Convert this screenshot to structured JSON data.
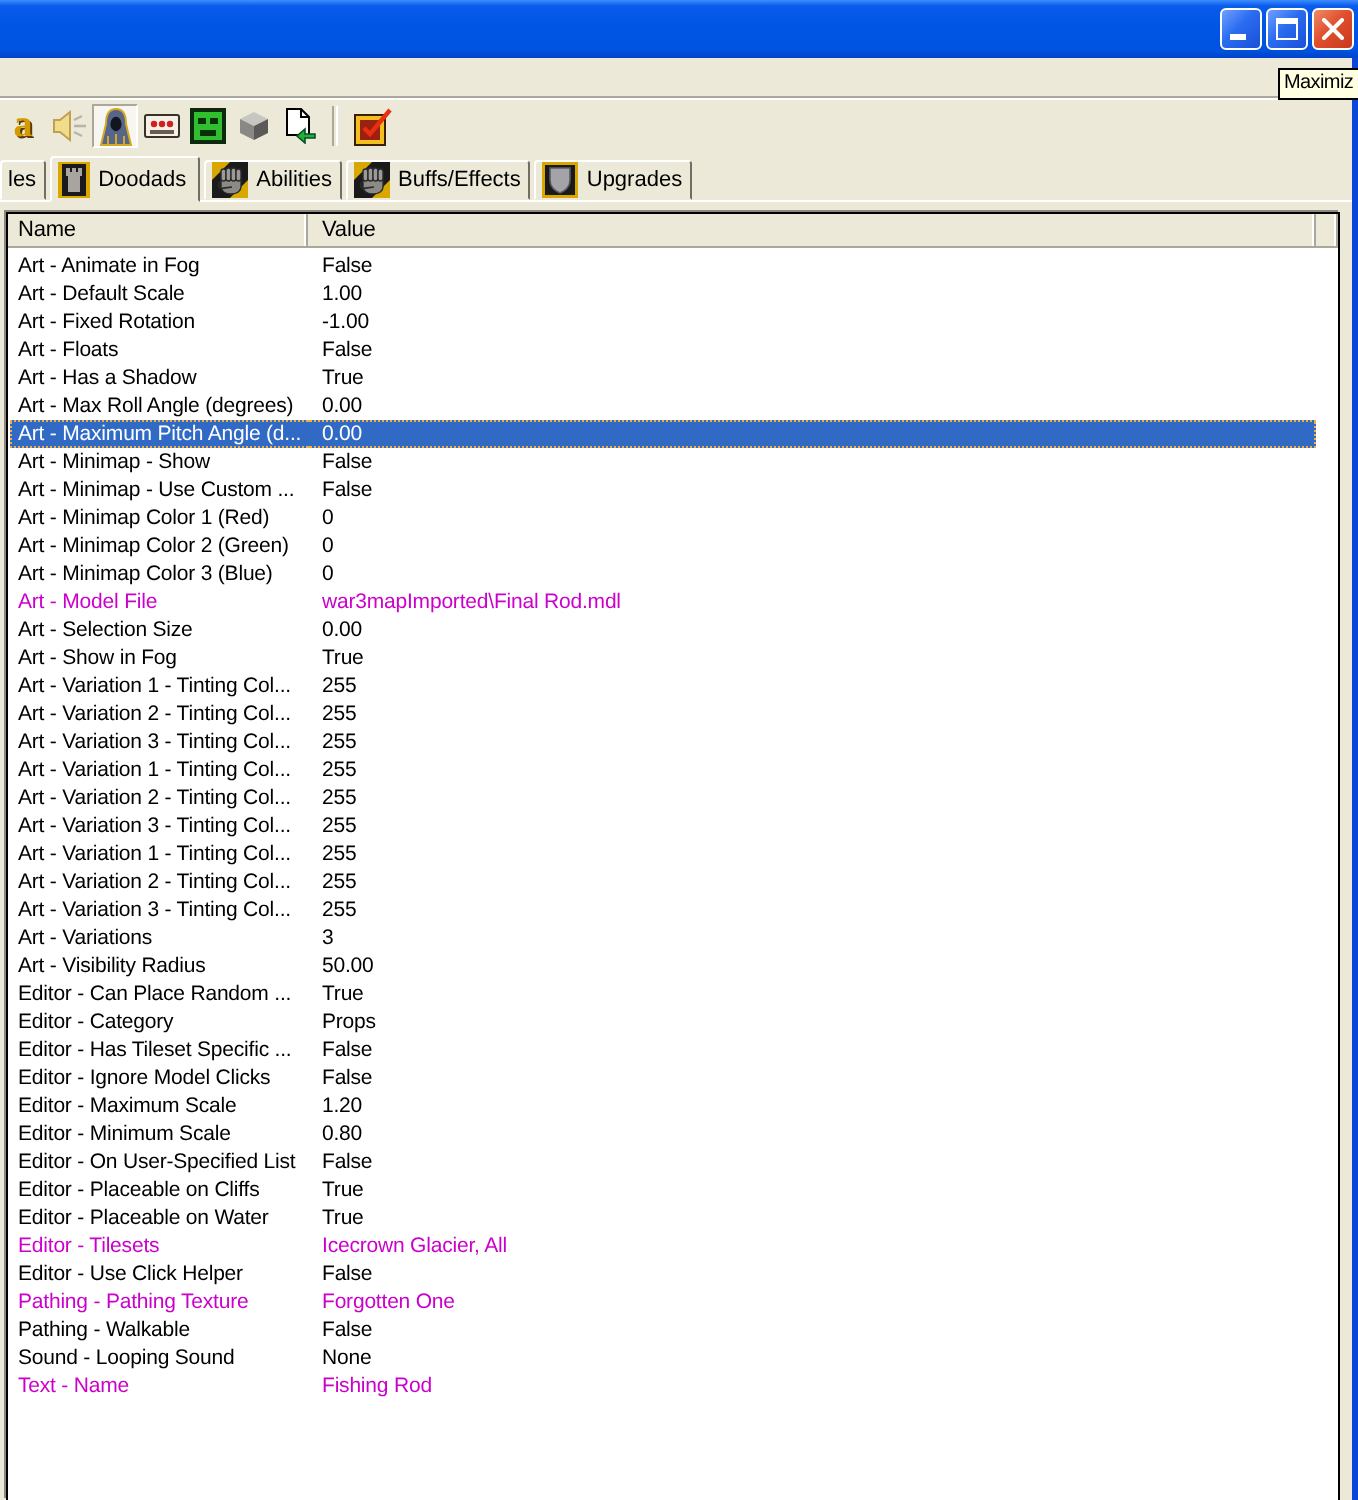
{
  "window": {
    "tooltip": "Maximiz"
  },
  "toolbar": {
    "groups": [
      [
        {
          "kind": "letter",
          "symbol": "a",
          "selected": false
        },
        {
          "kind": "icon",
          "selected": false
        },
        {
          "kind": "icon",
          "selected": true
        },
        {
          "kind": "icon",
          "selected": false
        },
        {
          "kind": "icon",
          "selected": false
        },
        {
          "kind": "icon",
          "selected": false
        },
        {
          "kind": "icon",
          "selected": false
        }
      ],
      [
        {
          "kind": "icon",
          "selected": false
        }
      ]
    ]
  },
  "tabs": [
    {
      "label": "les",
      "selected": false
    },
    {
      "label": "Doodads",
      "selected": true
    },
    {
      "label": "Abilities",
      "selected": false
    },
    {
      "label": "Buffs/Effects",
      "selected": false
    },
    {
      "label": "Upgrades",
      "selected": false
    }
  ],
  "table": {
    "columns": [
      "Name",
      "Value"
    ],
    "rows": [
      {
        "name": "Art - Animate in Fog",
        "value": "False",
        "modified": false,
        "selected": false
      },
      {
        "name": "Art - Default Scale",
        "value": "1.00",
        "modified": false,
        "selected": false
      },
      {
        "name": "Art - Fixed Rotation",
        "value": "-1.00",
        "modified": false,
        "selected": false
      },
      {
        "name": "Art - Floats",
        "value": "False",
        "modified": false,
        "selected": false
      },
      {
        "name": "Art - Has a Shadow",
        "value": "True",
        "modified": false,
        "selected": false
      },
      {
        "name": "Art - Max Roll Angle (degrees)",
        "value": "0.00",
        "modified": false,
        "selected": false
      },
      {
        "name": "Art - Maximum Pitch Angle (d...",
        "value": "0.00",
        "modified": false,
        "selected": true
      },
      {
        "name": "Art - Minimap - Show",
        "value": "False",
        "modified": false,
        "selected": false
      },
      {
        "name": "Art - Minimap - Use Custom ...",
        "value": "False",
        "modified": false,
        "selected": false
      },
      {
        "name": "Art - Minimap Color 1 (Red)",
        "value": "0",
        "modified": false,
        "selected": false
      },
      {
        "name": "Art - Minimap Color 2 (Green)",
        "value": "0",
        "modified": false,
        "selected": false
      },
      {
        "name": "Art - Minimap Color 3 (Blue)",
        "value": "0",
        "modified": false,
        "selected": false
      },
      {
        "name": "Art - Model File",
        "value": "war3mapImported\\Final Rod.mdl",
        "modified": true,
        "selected": false
      },
      {
        "name": "Art - Selection Size",
        "value": "0.00",
        "modified": false,
        "selected": false
      },
      {
        "name": "Art - Show in Fog",
        "value": "True",
        "modified": false,
        "selected": false
      },
      {
        "name": "Art - Variation 1 - Tinting Col...",
        "value": "255",
        "modified": false,
        "selected": false
      },
      {
        "name": "Art - Variation 2 - Tinting Col...",
        "value": "255",
        "modified": false,
        "selected": false
      },
      {
        "name": "Art - Variation 3 - Tinting Col...",
        "value": "255",
        "modified": false,
        "selected": false
      },
      {
        "name": "Art - Variation 1 - Tinting Col...",
        "value": "255",
        "modified": false,
        "selected": false
      },
      {
        "name": "Art - Variation 2 - Tinting Col...",
        "value": "255",
        "modified": false,
        "selected": false
      },
      {
        "name": "Art - Variation 3 - Tinting Col...",
        "value": "255",
        "modified": false,
        "selected": false
      },
      {
        "name": "Art - Variation 1 - Tinting Col...",
        "value": "255",
        "modified": false,
        "selected": false
      },
      {
        "name": "Art - Variation 2 - Tinting Col...",
        "value": "255",
        "modified": false,
        "selected": false
      },
      {
        "name": "Art - Variation 3 - Tinting Col...",
        "value": "255",
        "modified": false,
        "selected": false
      },
      {
        "name": "Art - Variations",
        "value": "3",
        "modified": false,
        "selected": false
      },
      {
        "name": "Art - Visibility Radius",
        "value": "50.00",
        "modified": false,
        "selected": false
      },
      {
        "name": "Editor - Can Place Random ...",
        "value": "True",
        "modified": false,
        "selected": false
      },
      {
        "name": "Editor - Category",
        "value": "Props",
        "modified": false,
        "selected": false
      },
      {
        "name": "Editor - Has Tileset Specific ...",
        "value": "False",
        "modified": false,
        "selected": false
      },
      {
        "name": "Editor - Ignore Model Clicks",
        "value": "False",
        "modified": false,
        "selected": false
      },
      {
        "name": "Editor - Maximum Scale",
        "value": "1.20",
        "modified": false,
        "selected": false
      },
      {
        "name": "Editor - Minimum Scale",
        "value": "0.80",
        "modified": false,
        "selected": false
      },
      {
        "name": "Editor - On User-Specified List",
        "value": "False",
        "modified": false,
        "selected": false
      },
      {
        "name": "Editor - Placeable on Cliffs",
        "value": "True",
        "modified": false,
        "selected": false
      },
      {
        "name": "Editor - Placeable on Water",
        "value": "True",
        "modified": false,
        "selected": false
      },
      {
        "name": "Editor - Tilesets",
        "value": "Icecrown Glacier, All",
        "modified": true,
        "selected": false
      },
      {
        "name": "Editor - Use Click Helper",
        "value": "False",
        "modified": false,
        "selected": false
      },
      {
        "name": "Pathing - Pathing Texture",
        "value": "Forgotten One",
        "modified": true,
        "selected": false
      },
      {
        "name": "Pathing - Walkable",
        "value": "False",
        "modified": false,
        "selected": false
      },
      {
        "name": "Sound - Looping Sound",
        "value": "None",
        "modified": false,
        "selected": false
      },
      {
        "name": "Text - Name",
        "value": "Fishing Rod",
        "modified": true,
        "selected": false
      }
    ]
  }
}
